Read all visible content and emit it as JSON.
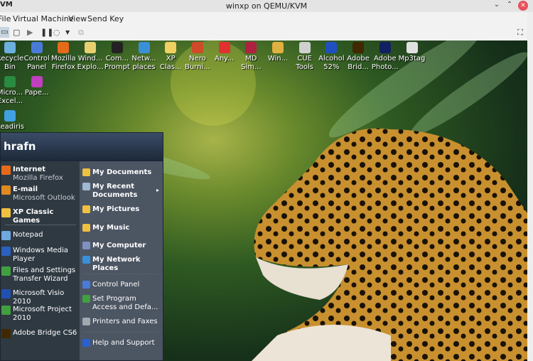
{
  "window": {
    "title": "winxp on QEMU/KVM",
    "logo": "VM",
    "buttons": [
      "minimize",
      "maximize",
      "close"
    ]
  },
  "menubar": [
    "File",
    "Virtual Machine",
    "View",
    "Send Key"
  ],
  "toolbar": {
    "icons": [
      "console-icon",
      "details-icon",
      "play-icon",
      "pause-icon",
      "power-icon",
      "dropdown-icon",
      "snapshot-icon",
      "fullscreen-icon"
    ]
  },
  "desktop": {
    "icons": [
      {
        "l1": "Recycle",
        "l2": "Bin",
        "color": "#6cb0e0"
      },
      {
        "l1": "Control",
        "l2": "Panel",
        "color": "#4a7ad8"
      },
      {
        "l1": "Mozilla",
        "l2": "Firefox",
        "color": "#e56a1a"
      },
      {
        "l1": "Wind...",
        "l2": "Explo...",
        "color": "#e8d070"
      },
      {
        "l1": "Com...",
        "l2": "Prompt",
        "color": "#222222"
      },
      {
        "l1": "Netw...",
        "l2": "places",
        "color": "#3a90d8"
      },
      {
        "l1": "XP",
        "l2": "Clas...",
        "color": "#f0d060"
      },
      {
        "l1": "Nero",
        "l2": "Burni...",
        "color": "#d04a2a"
      },
      {
        "l1": "Any...",
        "l2": "",
        "color": "#e03030"
      },
      {
        "l1": "MD",
        "l2": "Sim...",
        "color": "#b02040"
      },
      {
        "l1": "Win...",
        "l2": "",
        "color": "#e0b040"
      },
      {
        "l1": "CUE",
        "l2": "Tools",
        "color": "#d0d0d0"
      },
      {
        "l1": "Alcohol",
        "l2": "52%",
        "color": "#2050c0"
      },
      {
        "l1": "Adobe",
        "l2": "Brid...",
        "color": "#402800"
      },
      {
        "l1": "Adobe",
        "l2": "Photo...",
        "color": "#102060"
      },
      {
        "l1": "Mp3tag",
        "l2": "",
        "color": "#e0e0e0"
      }
    ],
    "row2": [
      {
        "l1": "Micro...",
        "l2": "Excel...",
        "color": "#2a8a40"
      },
      {
        "l1": "Pape...",
        "l2": "",
        "color": "#c040c0"
      }
    ],
    "row3": [
      {
        "l1": "Readiris",
        "l2": "",
        "color": "#40a0e0"
      }
    ]
  },
  "startmenu": {
    "user": "hrafn",
    "pinned": [
      {
        "title": "Internet",
        "sub": "Mozilla Firefox",
        "color": "#e56a1a"
      },
      {
        "title": "E-mail",
        "sub": "Microsoft Outlook",
        "color": "#e08a20"
      },
      {
        "title": "XP Classic Games",
        "color": "#f0c040"
      }
    ],
    "recent": [
      {
        "l1": "Notepad",
        "color": "#70a8e0"
      },
      {
        "l1": "Windows Media",
        "l2": "Player",
        "color": "#2a60c0"
      },
      {
        "l1": "Files and Settings",
        "l2": "Transfer Wizard",
        "color": "#40a040"
      },
      {
        "l1": "Microsoft Visio 2010",
        "color": "#2050b0"
      },
      {
        "l1": "Microsoft Project",
        "l2": "2010",
        "color": "#40a040"
      },
      {
        "l1": "Adobe Bridge CS6",
        "color": "#402800"
      }
    ],
    "places": [
      {
        "l1": "My Documents",
        "bold": true,
        "color": "#f0c040"
      },
      {
        "l1": "My Recent",
        "l2": "Documents",
        "bold": true,
        "color": "#a0b8d0",
        "arrow": "▸"
      },
      {
        "l1": "My Pictures",
        "bold": true,
        "color": "#f0c040"
      },
      {
        "l1": "My Music",
        "bold": true,
        "color": "#f0c040"
      },
      {
        "l1": "My Computer",
        "bold": true,
        "color": "#8090c0"
      },
      {
        "l1": "My Network",
        "l2": "Places",
        "bold": true,
        "color": "#3a90d8"
      },
      {
        "l1": "Control Panel",
        "color": "#4a7ad8"
      },
      {
        "l1": "Set Program",
        "l2": "Access and Defa...",
        "color": "#40a040"
      },
      {
        "l1": "Printers and Faxes",
        "color": "#a0a8b0"
      },
      {
        "l1": "Help and Support",
        "color": "#2a60d0"
      }
    ]
  }
}
